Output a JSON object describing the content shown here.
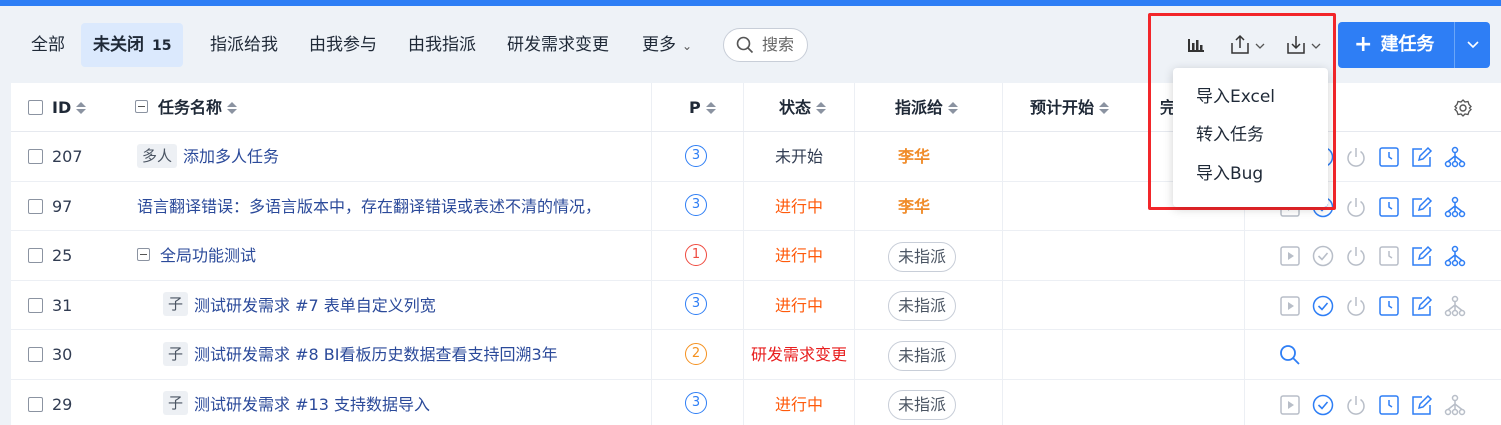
{
  "filter_tabs": {
    "all": "全部",
    "open": "未关闭",
    "open_count": "15",
    "assigned_to_me": "指派给我",
    "involved": "由我参与",
    "assigned_by_me": "由我指派",
    "story_changed": "研发需求变更",
    "more": "更多"
  },
  "search": {
    "label": "搜索"
  },
  "toolbar": {
    "new_task": "建任务"
  },
  "import_menu": [
    "导入Excel",
    "转入任务",
    "导入Bug"
  ],
  "columns": {
    "id": "ID",
    "name": "任务名称",
    "pri": "P",
    "status": "状态",
    "assigned": "指派给",
    "est_start": "预计开始",
    "truncated": "完"
  },
  "rows": [
    {
      "id": "207",
      "tag": "多人",
      "title": "添加多人任务",
      "pri": "3",
      "status": "未开始",
      "assigned": "李华"
    },
    {
      "id": "97",
      "tag": "",
      "title": "语言翻译错误：多语言版本中，存在翻译错误或表述不清的情况，",
      "pri": "3",
      "status": "进行中",
      "assigned": "李华"
    },
    {
      "id": "25",
      "tag": "",
      "title": "全局功能测试",
      "pri": "1",
      "status": "进行中",
      "assigned": "未指派"
    },
    {
      "id": "31",
      "tag": "子",
      "title": "测试研发需求 #7 表单自定义列宽",
      "pri": "3",
      "status": "进行中",
      "assigned": "未指派"
    },
    {
      "id": "30",
      "tag": "子",
      "title": "测试研发需求 #8 BI看板历史数据查看支持回溯3年",
      "pri": "2",
      "status": "研发需求变更",
      "assigned": "未指派"
    },
    {
      "id": "29",
      "tag": "子",
      "title": "测试研发需求 #13 支持数据导入",
      "pri": "3",
      "status": "进行中",
      "assigned": "未指派"
    }
  ],
  "colors": {
    "accent": "#2e7ef5",
    "status_wait": "#313c52",
    "status_doing": "#ff5a0b",
    "status_changed": "#e81e1e",
    "assignee": "#f08c2a",
    "pri1": "#ef4a3f",
    "pri2": "#f5911f",
    "pri3": "#2e7ef5",
    "highlight_box": "#f2262a"
  }
}
